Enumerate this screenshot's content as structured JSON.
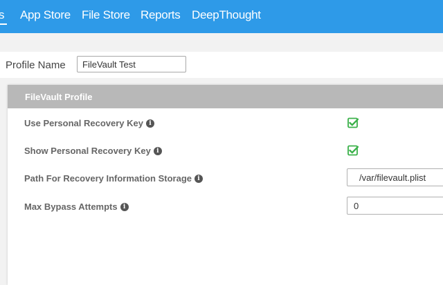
{
  "nav": {
    "items": [
      {
        "label": "s"
      },
      {
        "label": "App Store"
      },
      {
        "label": "File Store"
      },
      {
        "label": "Reports"
      },
      {
        "label": "DeepThought"
      }
    ],
    "background": "#2e9ae8"
  },
  "profile": {
    "name_label": "Profile Name",
    "name_value": "FileVault Test"
  },
  "panel": {
    "title": "FileVault Profile",
    "header_color": "#b8b8b8",
    "rows": [
      {
        "label": "Use Personal Recovery Key",
        "checked": true
      },
      {
        "label": "Show Personal Recovery Key",
        "checked": true
      },
      {
        "label": "Path For Recovery Information Storage",
        "value": "/var/filevault.plist"
      },
      {
        "label": "Max Bypass Attempts",
        "value": "0"
      }
    ]
  },
  "icons": {
    "info": "info-circle-icon",
    "info_glyph": "i",
    "checkbox": "checkbox-checked-icon"
  },
  "colors": {
    "check_green": "#3bb14a"
  }
}
